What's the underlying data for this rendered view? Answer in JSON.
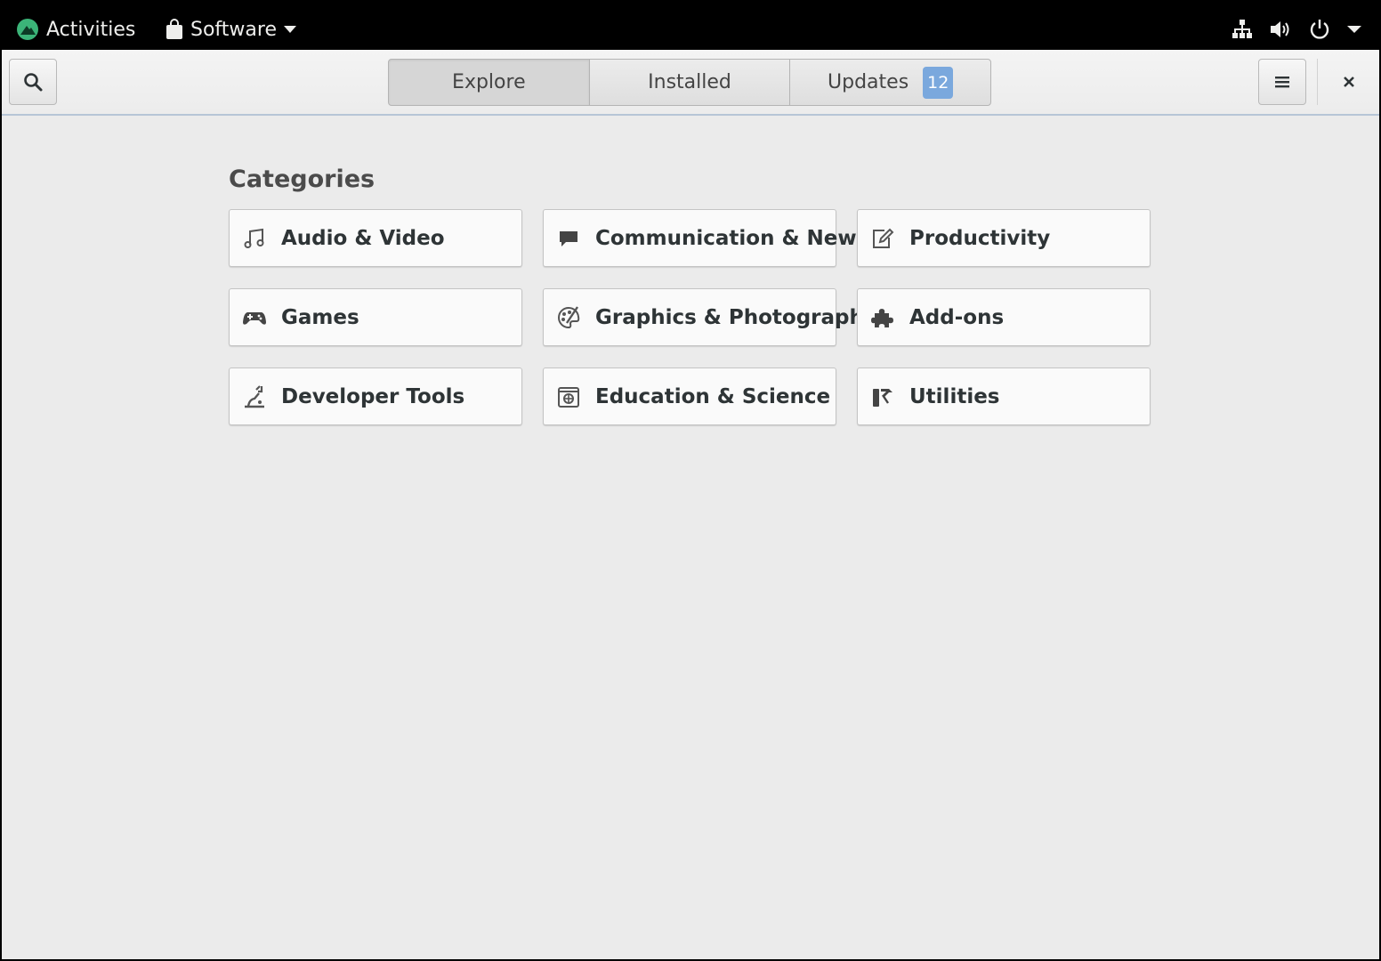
{
  "topbar": {
    "activities_label": "Activities",
    "app_name": "Software"
  },
  "header": {
    "tabs": [
      {
        "label": "Explore",
        "active": true
      },
      {
        "label": "Installed",
        "active": false
      },
      {
        "label": "Updates",
        "active": false,
        "badge": "12"
      }
    ]
  },
  "main": {
    "section_title": "Categories",
    "categories": [
      {
        "label": "Audio & Video",
        "icon": "music-note-icon"
      },
      {
        "label": "Communication & News",
        "icon": "chat-bubble-icon"
      },
      {
        "label": "Productivity",
        "icon": "edit-document-icon"
      },
      {
        "label": "Games",
        "icon": "gamepad-icon"
      },
      {
        "label": "Graphics & Photography",
        "icon": "palette-icon"
      },
      {
        "label": "Add-ons",
        "icon": "puzzle-piece-icon"
      },
      {
        "label": "Developer Tools",
        "icon": "developer-tools-icon"
      },
      {
        "label": "Education & Science",
        "icon": "science-icon"
      },
      {
        "label": "Utilities",
        "icon": "utilities-icon"
      }
    ]
  },
  "colors": {
    "accent_badge": "#7aa8dd",
    "logo_green": "#3bb478",
    "window_bg": "#ebebeb"
  }
}
